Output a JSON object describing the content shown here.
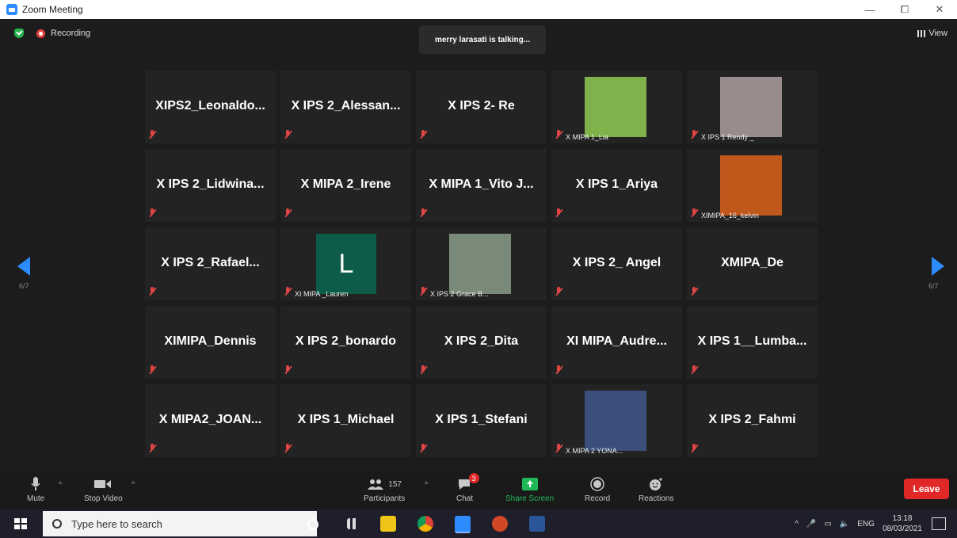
{
  "window": {
    "title": "Zoom Meeting",
    "minimize": "—",
    "maximize": "⧠",
    "close": "✕"
  },
  "meeting": {
    "recording_label": "Recording",
    "talking_text": "merry larasati is talking...",
    "view_label": "View",
    "page_indicator_left": "6/7",
    "page_indicator_right": "6/7"
  },
  "participants": [
    {
      "name": "XIPS2_Leonaldo...",
      "video": false
    },
    {
      "name": "X IPS 2_Alessan...",
      "video": false
    },
    {
      "name": "X IPS 2- Re",
      "video": false
    },
    {
      "name": "X MIPA 1_Lia",
      "video": true,
      "photo_color": "#7fb24a"
    },
    {
      "name": "X IPS 1 Rendy _",
      "video": true,
      "photo_color": "#9a8c8c"
    },
    {
      "name": "X IPS 2_Lidwina...",
      "video": false
    },
    {
      "name": "X MIPA 2_Irene",
      "video": false
    },
    {
      "name": "X MIPA 1_Vito J...",
      "video": false
    },
    {
      "name": "X IPS 1_Ariya",
      "video": false
    },
    {
      "name": "XIMIPA_16_kelvin",
      "video": true,
      "photo_color": "#c0581c"
    },
    {
      "name": "X IPS 2_Rafael...",
      "video": false
    },
    {
      "name": "XI MIPA _Lauren",
      "video": true,
      "avatar_letter": "L",
      "photo_color": "#0d5c4a"
    },
    {
      "name": "X IPS 2 Grace B...",
      "video": true,
      "photo_color": "#7a8a78"
    },
    {
      "name": "X IPS 2_ Angel",
      "video": false
    },
    {
      "name": "XMIPA_De",
      "video": false
    },
    {
      "name": "XIMIPA_Dennis",
      "video": false
    },
    {
      "name": "X IPS 2_bonardo",
      "video": false
    },
    {
      "name": "X IPS 2_Dita",
      "video": false
    },
    {
      "name": "XI  MIPA_Audre...",
      "video": false
    },
    {
      "name": "X IPS 1__Lumba...",
      "video": false
    },
    {
      "name": "X  MIPA2_JOAN...",
      "video": false
    },
    {
      "name": "X IPS 1_Michael",
      "video": false
    },
    {
      "name": "X IPS 1_Stefani",
      "video": false
    },
    {
      "name": "X MIPA 2 YONA...",
      "video": true,
      "photo_color": "#3c4f7a"
    },
    {
      "name": "X IPS 2_Fahmi",
      "video": false
    }
  ],
  "toolbar": {
    "mute": "Mute",
    "stop_video": "Stop Video",
    "participants": "Participants",
    "participants_count": "157",
    "chat": "Chat",
    "chat_badge": "3",
    "share_screen": "Share Screen",
    "record": "Record",
    "reactions": "Reactions",
    "leave": "Leave"
  },
  "taskbar": {
    "search_placeholder": "Type here to search",
    "language": "ENG",
    "time": "13:18",
    "date": "08/03/2021"
  }
}
